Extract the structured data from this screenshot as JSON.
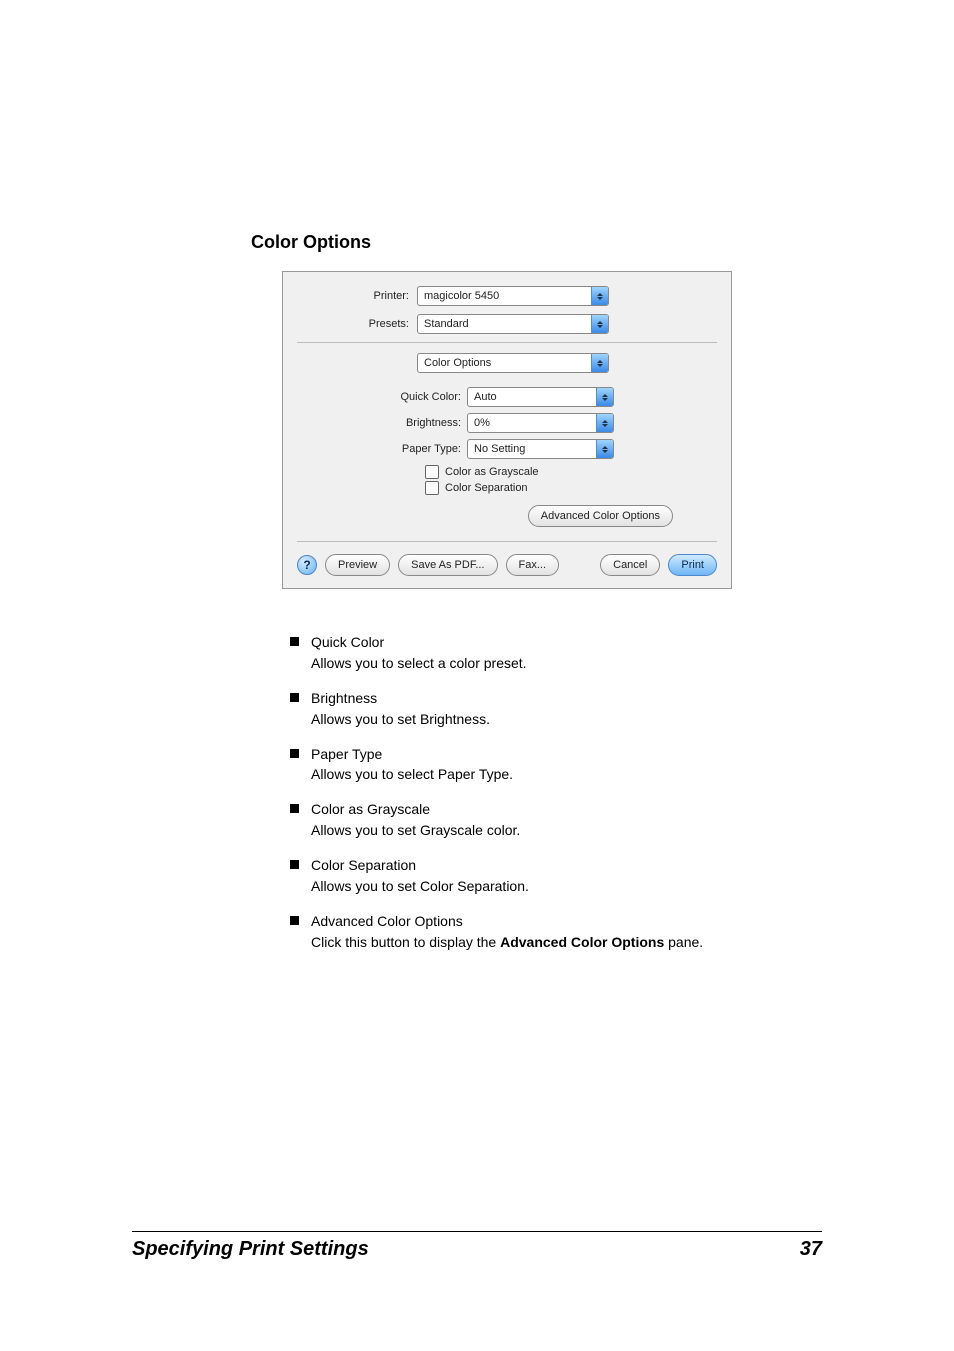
{
  "section_title": "Color Options",
  "dialog": {
    "printer_label": "Printer:",
    "printer_value": "magicolor 5450",
    "presets_label": "Presets:",
    "presets_value": "Standard",
    "pane_value": "Color Options",
    "quick_color_label": "Quick Color:",
    "quick_color_value": "Auto",
    "brightness_label": "Brightness:",
    "brightness_value": "0%",
    "paper_type_label": "Paper Type:",
    "paper_type_value": "No Setting",
    "grayscale_label": "Color as Grayscale",
    "separation_label": "Color Separation",
    "advanced_button": "Advanced Color Options",
    "help_symbol": "?",
    "preview_button": "Preview",
    "save_pdf_button": "Save As PDF...",
    "fax_button": "Fax...",
    "cancel_button": "Cancel",
    "print_button": "Print"
  },
  "bullets": [
    {
      "title": "Quick Color",
      "desc": "Allows you to select a color preset."
    },
    {
      "title": "Brightness",
      "desc": "Allows you to set Brightness."
    },
    {
      "title": "Paper Type",
      "desc": "Allows you to select Paper Type."
    },
    {
      "title": "Color as Grayscale",
      "desc": "Allows you to set Grayscale color."
    },
    {
      "title": "Color Separation",
      "desc": "Allows you to set Color Separation."
    },
    {
      "title": "Advanced Color Options",
      "desc_pre": "Click this button to display the ",
      "desc_bold": "Advanced Color Options",
      "desc_post": " pane."
    }
  ],
  "footer": {
    "title": "Specifying Print Settings",
    "page_number": "37"
  }
}
